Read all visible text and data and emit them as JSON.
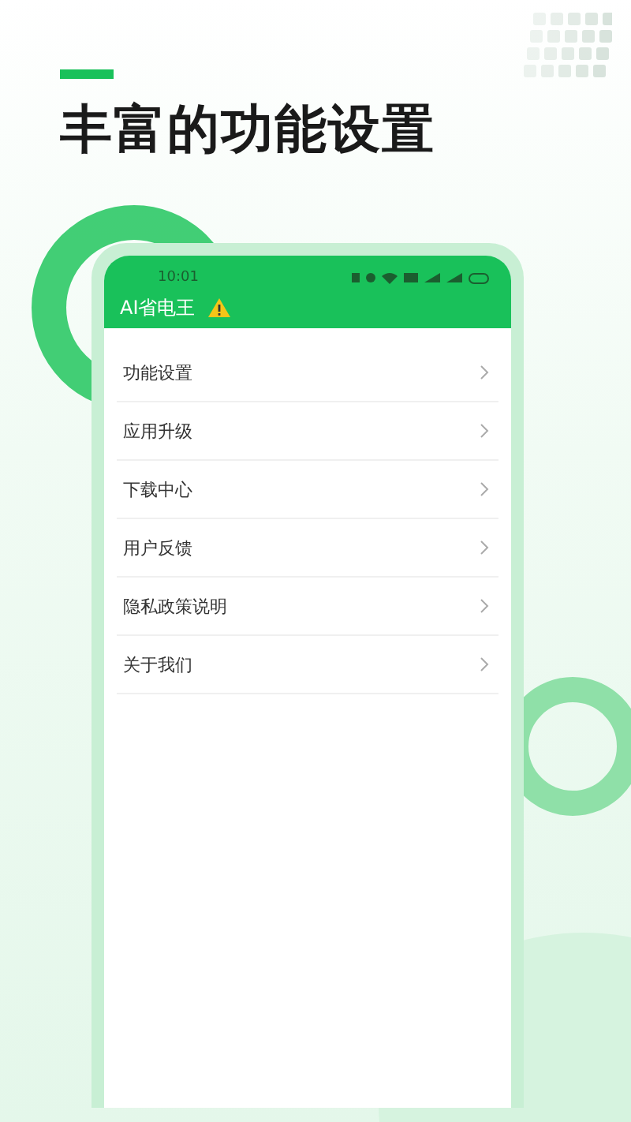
{
  "headline": "丰富的功能设置",
  "phone": {
    "status_bar": {
      "time": "10:01"
    },
    "app_title": "AI省电王",
    "warning": true,
    "menu_items": [
      {
        "label": "功能设置"
      },
      {
        "label": "应用升级"
      },
      {
        "label": "下载中心"
      },
      {
        "label": "用户反馈"
      },
      {
        "label": "隐私政策说明"
      },
      {
        "label": "关于我们"
      }
    ]
  }
}
